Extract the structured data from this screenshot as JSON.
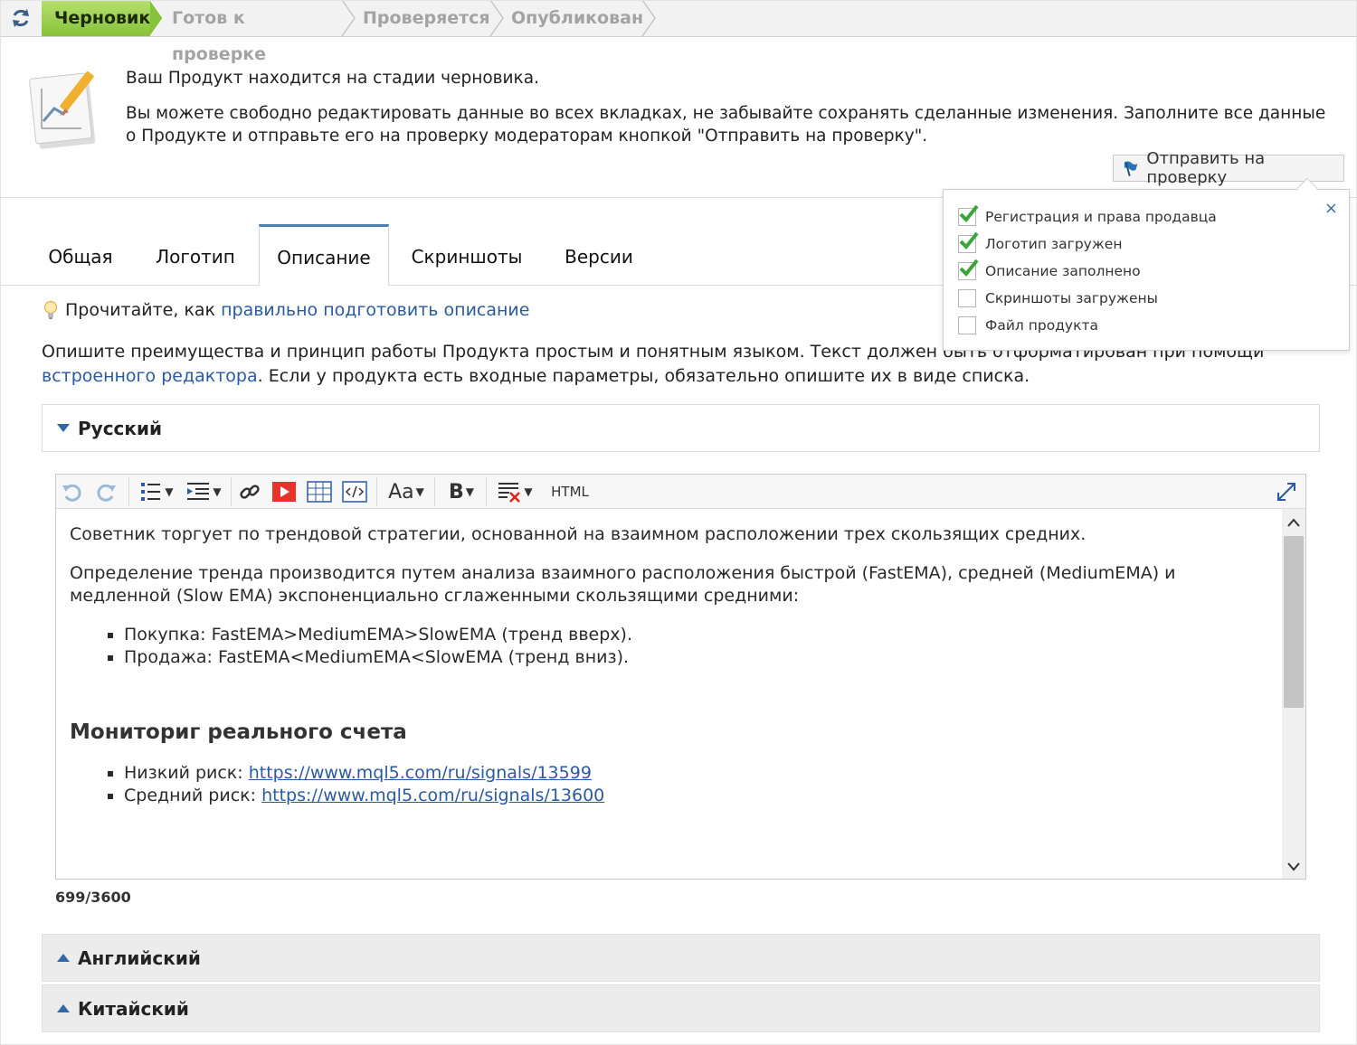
{
  "statusbar": {
    "steps": [
      {
        "label": "Черновик",
        "active": true
      },
      {
        "label": "Готов к проверке",
        "active": false
      },
      {
        "label": "Проверяется",
        "active": false
      },
      {
        "label": "Опубликован",
        "active": false
      }
    ]
  },
  "info": {
    "line1": "Ваш Продукт находится на стадии черновика.",
    "line2": "Вы можете свободно редактировать данные во всех вкладках, не забывайте сохранять сделанные изменения. Заполните все данные о Продукте и отправьте его на проверку модераторам кнопкой \"Отправить на проверку\".",
    "submit_label": "Отправить на проверку"
  },
  "checklist": {
    "close_label": "×",
    "items": [
      {
        "label": "Регистрация и права продавца",
        "checked": true
      },
      {
        "label": "Логотип загружен",
        "checked": true
      },
      {
        "label": "Описание заполнено",
        "checked": true
      },
      {
        "label": "Скриншоты загружены",
        "checked": false
      },
      {
        "label": "Файл продукта",
        "checked": false
      }
    ]
  },
  "tabs": [
    {
      "label": "Общая",
      "active": false
    },
    {
      "label": "Логотип",
      "active": false
    },
    {
      "label": "Описание",
      "active": true
    },
    {
      "label": "Скриншоты",
      "active": false
    },
    {
      "label": "Версии",
      "active": false
    }
  ],
  "hint": {
    "prefix": "Прочитайте, как ",
    "link": "правильно подготовить описание"
  },
  "description": {
    "part1": "Опишите преимущества и принцип работы Продукта простым и понятным языком. Текст должен быть отформатирован при помощи ",
    "link": "встроенного редактора",
    "part2": ". Если у продукта есть входные параметры, обязательно опишите их в виде списка."
  },
  "languages": {
    "russian": "Русский",
    "english": "Английский",
    "chinese": "Китайский"
  },
  "editor": {
    "toolbar": {
      "font_label": "Aa",
      "bold_label": "B",
      "html_label": "HTML"
    },
    "content": {
      "p1": "Советник торгует по трендовой стратегии, основанной на взаимном расположении трех скользящих средних.",
      "p2": "Определение тренда производится путем анализа взаимного расположения быстрой (FastEMA), средней (MediumEMA) и медленной (Slow EMA) экспоненциально сглаженными скользящими средними:",
      "list1": [
        "Покупка: FastEMA>MediumEMA>SlowEMA (тренд вверх).",
        "Продажа: FastEMA<MediumEMA<SlowEMA (тренд вниз)."
      ],
      "heading": "Мониториг реального счета",
      "monitor": [
        {
          "prefix": "Низкий риск: ",
          "link": "https://www.mql5.com/ru/signals/13599"
        },
        {
          "prefix": "Средний риск: ",
          "link": "https://www.mql5.com/ru/signals/13600"
        }
      ]
    },
    "counter": "699/3600"
  },
  "colors": {
    "active_step": "#86c23a",
    "link": "#2a5aa0",
    "tab_accent": "#4a7fb0",
    "check_green": "#3aa63a"
  }
}
